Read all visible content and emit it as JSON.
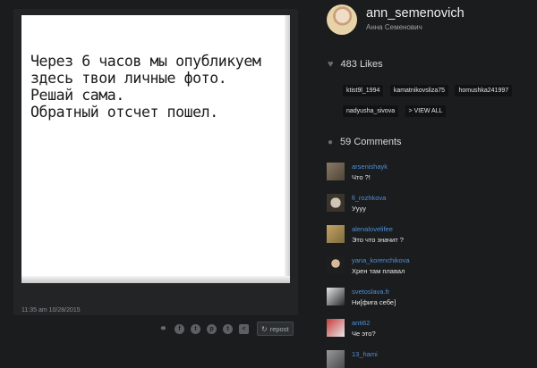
{
  "post": {
    "image_text_lines": [
      "Через 6 часов мы опубликуем",
      "здесь твои личные фото.",
      "Решай сама.",
      "Обратный отсчет пошел."
    ],
    "timestamp": "11:35 am 10/28/2015",
    "share_icons": [
      "link-icon",
      "facebook-icon",
      "twitter-icon",
      "pinterest-icon",
      "tumblr-icon",
      "share-icon"
    ],
    "repost_label": "repost"
  },
  "profile": {
    "username": "ann_semenovich",
    "full_name": "Анна Семенович"
  },
  "likes": {
    "count_label": "483 Likes",
    "likers": [
      "ktist9l_1994",
      "kamatnikovsliza75",
      "homushka241997",
      "nadyusha_sivova"
    ],
    "view_all_label": "> VIEW ALL"
  },
  "comments": {
    "count_label": "59 Comments",
    "items": [
      {
        "user": "arsenishayk",
        "text": "Что ?!"
      },
      {
        "user": "fi_rozhkova",
        "text": "Уууу"
      },
      {
        "user": "alenalovelifee",
        "text": "Это что значит ?"
      },
      {
        "user": "yana_korenchikova",
        "text": "Хрен там плавал"
      },
      {
        "user": "svetoslava.fr",
        "text": "Ни[фига себе]"
      },
      {
        "user": "anti62",
        "text": "Че это?"
      },
      {
        "user": "13_hami",
        "text": ""
      }
    ]
  },
  "colors": {
    "background": "#1b1c1d",
    "link": "#4c8fd9"
  }
}
